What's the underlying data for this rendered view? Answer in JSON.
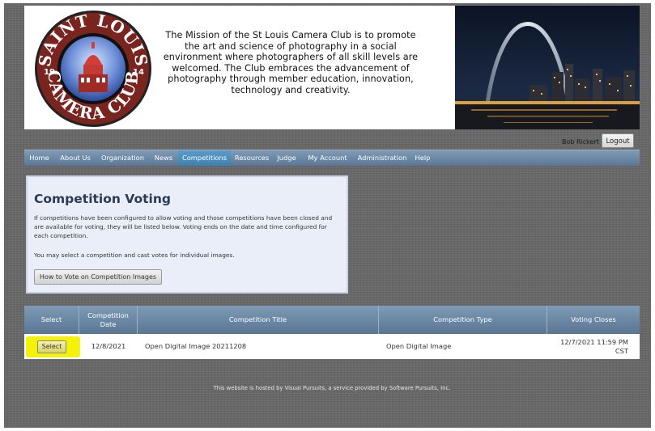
{
  "header": {
    "logo": {
      "top_text": "SAINT LOUIS",
      "bottom_text": "CAMERA CLUB",
      "year_left": "19",
      "year_right": "14"
    },
    "mission": "The Mission of the St Louis Camera Club is to promote the art and science of photography in a social environment where photographers of all skill levels are welcomed. The Club embraces the advancement of photography through member education, innovation, technology and creativity."
  },
  "user": {
    "name": "Bob Rickert",
    "logout_label": "Logout"
  },
  "nav": {
    "items": [
      {
        "label": "Home"
      },
      {
        "label": "About Us"
      },
      {
        "label": "Organization"
      },
      {
        "label": "News"
      },
      {
        "label": "Competitions",
        "active": true
      },
      {
        "label": "Resources"
      },
      {
        "label": "Judge"
      },
      {
        "label": "My Account"
      },
      {
        "label": "Administration"
      },
      {
        "label": "Help"
      }
    ]
  },
  "voting": {
    "title": "Competition Voting",
    "paragraph1": "If competitions have been configured to allow voting and those competitions have been closed and are available for voting, they will be listed below. Voting ends on the date and time configured for each competition.",
    "paragraph2": "You may select a competition and cast votes for individual images.",
    "how_to_button": "How to Vote on Competition Images"
  },
  "table": {
    "headers": [
      "Select",
      "Competition Date",
      "Competition Title",
      "Competition Type",
      "Voting Closes"
    ],
    "rows": [
      {
        "select_label": "Select",
        "date": "12/8/2021",
        "title": "Open Digital Image 20211208",
        "type": "Open Digital Image",
        "closes": "12/7/2021 11:59 PM CST"
      }
    ]
  },
  "footer": {
    "text": "This website is hosted by Visual Pursuits, a service provided by Software Pursuits, Inc."
  },
  "colors": {
    "nav_bar": "#6f8ba7",
    "nav_active": "#4b8cba",
    "panel_bg": "#e9eef8",
    "title_color": "#2b3a55",
    "highlight": "#f5f20a"
  }
}
